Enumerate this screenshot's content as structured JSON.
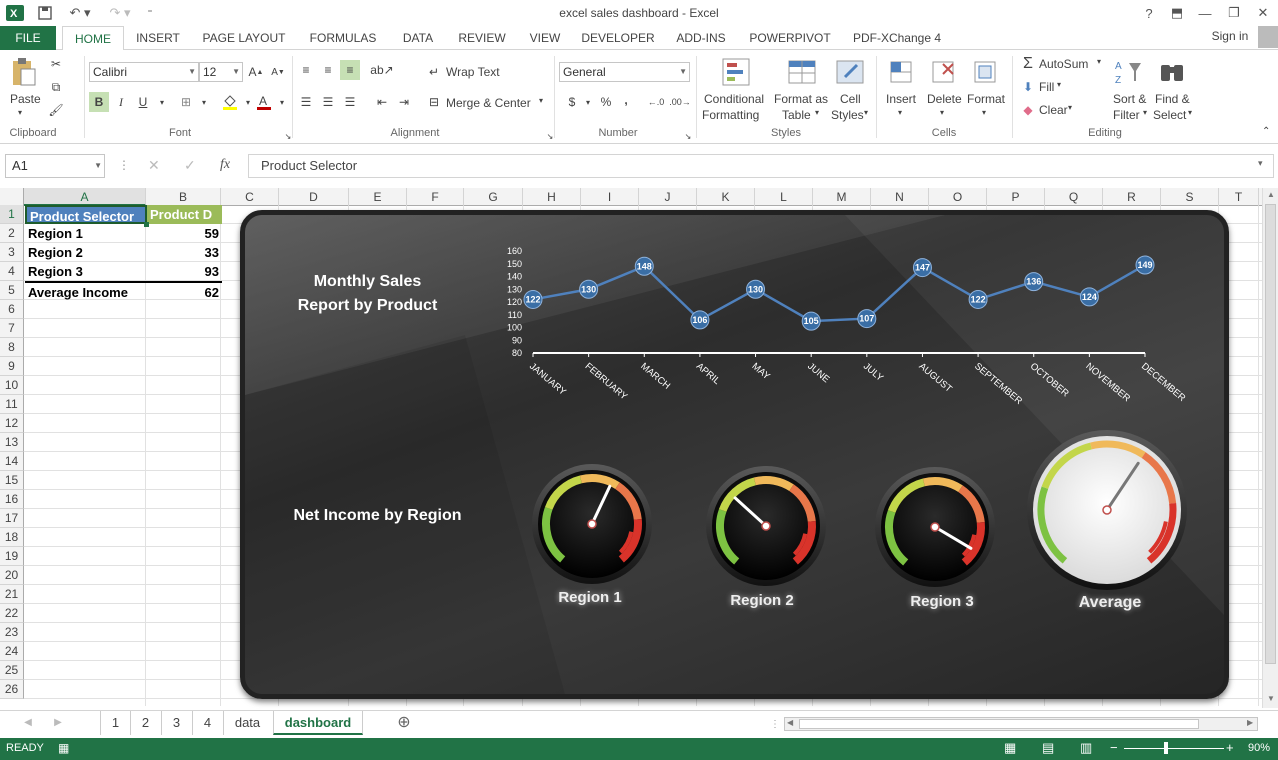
{
  "window": {
    "title": "excel sales dashboard - Excel",
    "help": "?",
    "signin": "Sign in"
  },
  "tabs": [
    "FILE",
    "HOME",
    "INSERT",
    "PAGE LAYOUT",
    "FORMULAS",
    "DATA",
    "REVIEW",
    "VIEW",
    "DEVELOPER",
    "ADD-INS",
    "POWERPIVOT",
    "PDF-XChange 4"
  ],
  "ribbon": {
    "clipboard": {
      "paste": "Paste",
      "label": "Clipboard"
    },
    "font": {
      "name": "Calibri",
      "size": "12",
      "bold": "B",
      "italic": "I",
      "underline": "U",
      "label": "Font"
    },
    "alignment": {
      "wrap": "Wrap Text",
      "merge": "Merge & Center",
      "label": "Alignment"
    },
    "number": {
      "format": "General",
      "currency": "$",
      "percent": "%",
      "comma": ",",
      "label": "Number"
    },
    "styles": {
      "conditional1": "Conditional",
      "conditional2": "Formatting",
      "formatas1": "Format as",
      "formatas2": "Table",
      "cell1": "Cell",
      "cell2": "Styles",
      "label": "Styles"
    },
    "cells": {
      "insert": "Insert",
      "delete": "Delete",
      "format": "Format",
      "label": "Cells"
    },
    "editing": {
      "autosum": "AutoSum",
      "fill": "Fill",
      "clear": "Clear",
      "sort1": "Sort &",
      "sort2": "Filter",
      "find1": "Find &",
      "find2": "Select",
      "label": "Editing"
    }
  },
  "formula_bar": {
    "name_box": "A1",
    "fx": "fx",
    "content": "Product Selector"
  },
  "columns": [
    "A",
    "B",
    "C",
    "D",
    "E",
    "F",
    "G",
    "H",
    "I",
    "J",
    "K",
    "L",
    "M",
    "N",
    "O",
    "P",
    "Q",
    "R",
    "S",
    "T"
  ],
  "rows": [
    "1",
    "2",
    "3",
    "4",
    "5",
    "6",
    "7",
    "8",
    "9",
    "10",
    "11",
    "12",
    "13",
    "14",
    "15",
    "16",
    "17",
    "18",
    "19",
    "20",
    "21",
    "22",
    "23",
    "24",
    "25",
    "26"
  ],
  "cells": {
    "a1": "Product Selector",
    "b1": "Product D",
    "a2": "Region 1",
    "b2": "59",
    "a3": "Region 2",
    "b3": "33",
    "a4": "Region 3",
    "b4": "93",
    "a5": "Average Income",
    "b5": "62"
  },
  "dashboard": {
    "title_line1": "Monthly Sales",
    "title_line2": "Report by Product",
    "net_income": "Net Income by Region",
    "gauges": [
      {
        "label": "Region 1",
        "value": 59
      },
      {
        "label": "Region 2",
        "value": 33
      },
      {
        "label": "Region 3",
        "value": 93
      },
      {
        "label": "Average",
        "value": 62
      }
    ]
  },
  "chart_data": {
    "type": "line",
    "categories": [
      "JANUARY",
      "FEBRUARY",
      "MARCH",
      "APRIL",
      "MAY",
      "JUNE",
      "JULY",
      "AUGUST",
      "SEPTEMBER",
      "OCTOBER",
      "NOVEMBER",
      "DECEMBER"
    ],
    "values": [
      122,
      130,
      148,
      106,
      130,
      105,
      107,
      147,
      122,
      136,
      124,
      149
    ],
    "ylim": [
      80,
      160
    ],
    "yticks": [
      80,
      90,
      100,
      110,
      120,
      130,
      140,
      150,
      160
    ],
    "line_color": "#4f81bd",
    "marker_color": "#3a6ea5"
  },
  "sheets": [
    "1",
    "2",
    "3",
    "4",
    "data",
    "dashboard"
  ],
  "status": {
    "ready": "READY",
    "zoom": "90%"
  }
}
